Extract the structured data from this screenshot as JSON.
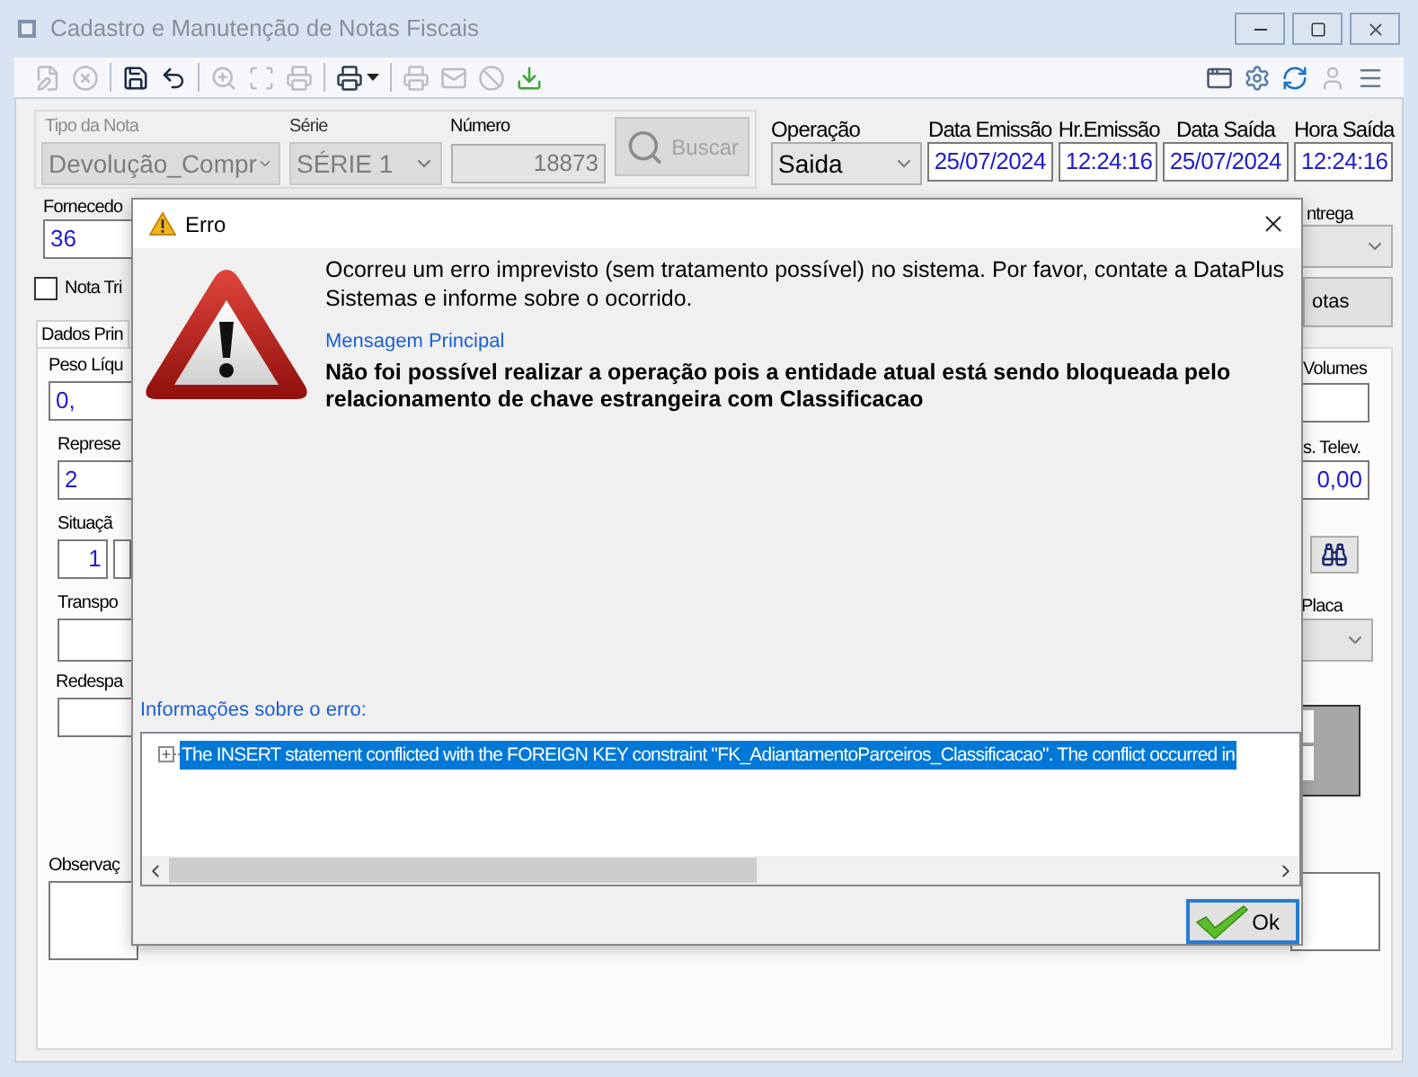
{
  "window": {
    "title": "Cadastro e Manutenção de Notas Fiscais"
  },
  "toolbar": {
    "groups": [
      [
        {
          "kind": "edit",
          "disabled": true
        },
        {
          "kind": "cancel",
          "disabled": true
        }
      ],
      [
        {
          "kind": "save",
          "disabled": false
        },
        {
          "kind": "undo",
          "disabled": false
        }
      ],
      [
        {
          "kind": "zoom",
          "disabled": true
        },
        {
          "kind": "scan",
          "disabled": true
        },
        {
          "kind": "print",
          "disabled": true
        }
      ],
      [
        {
          "kind": "print_menu",
          "disabled": false
        }
      ],
      [
        {
          "kind": "print",
          "disabled": true
        },
        {
          "kind": "mail",
          "disabled": true
        },
        {
          "kind": "block",
          "disabled": true
        },
        {
          "kind": "download",
          "disabled": false
        }
      ]
    ],
    "right": [
      {
        "kind": "window",
        "disabled": false
      },
      {
        "kind": "settings",
        "disabled": false
      },
      {
        "kind": "refresh",
        "disabled": false
      },
      {
        "kind": "user",
        "disabled": true
      },
      {
        "kind": "menu",
        "disabled": false
      }
    ]
  },
  "header": {
    "tipo_nota": {
      "label": "Tipo da Nota",
      "value": "Devolução_Compr",
      "disabled": true
    },
    "serie": {
      "label": "Série",
      "value": "SÉRIE 1",
      "disabled": true
    },
    "numero": {
      "label": "Número",
      "value": "18873",
      "disabled": true
    },
    "buscar": {
      "label": "Buscar",
      "disabled": true
    },
    "operacao": {
      "label": "Operação",
      "value": "Saida"
    },
    "dates": [
      {
        "label": "Data Emissão",
        "value": "25/07/2024"
      },
      {
        "label": "Hr.Emissão",
        "value": "12:24:16"
      },
      {
        "label": "Data Saída",
        "value": "25/07/2024"
      },
      {
        "label": "Hora Saída",
        "value": "12:24:16"
      }
    ]
  },
  "left": {
    "fornecedor": {
      "label": "Fornecedo",
      "value": "36"
    },
    "nota_tri": {
      "label": "Nota Tri",
      "checked": false
    },
    "tab": {
      "label": "Dados Prin",
      "selected": true
    },
    "peso_liquido": {
      "label": "Peso Líqu",
      "value": "0,"
    },
    "representante": {
      "label": "Represe",
      "value": "2"
    },
    "situacao": {
      "label": "Situaçã",
      "value": "1"
    },
    "transportadora": {
      "label": "Transpo"
    },
    "redespacho": {
      "label": "Redespa"
    },
    "observacao": {
      "label": "Observaç"
    }
  },
  "right": {
    "entrega": {
      "label": "ntrega"
    },
    "notas_button": "otas",
    "volumes": {
      "label": "Volumes"
    },
    "televendas": {
      "label": "s. Telev.",
      "value": "0,00"
    },
    "placa": {
      "label": "Placa"
    }
  },
  "dialog": {
    "title": "Erro",
    "message": "Ocorreu um erro imprevisto (sem tratamento possível) no sistema. Por favor, contate a DataPlus Sistemas e informe sobre o ocorrido.",
    "main_label": "Mensagem Principal",
    "main_message": "Não foi possível realizar a operação pois a entidade atual está sendo bloqueada pelo relacionamento de chave estrangeira com Classificacao",
    "details_label": "Informações sobre o erro:",
    "details": [
      {
        "text": "The INSERT statement conflicted with the FOREIGN KEY constraint \"FK_AdiantamentoParceiros_Classificacao\". The conflict occurred in",
        "expanded": false,
        "selected": true
      }
    ],
    "ok_button": "Ok"
  }
}
